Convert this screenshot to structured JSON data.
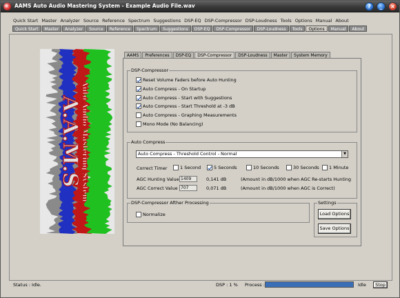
{
  "window": {
    "title": "AAMS Auto Audio Mastering System - Example Audio File.wav",
    "controls": {
      "help": "?",
      "minimize": "_",
      "maximize": "□",
      "close": "×"
    }
  },
  "menu": [
    "Quick Start",
    "Master",
    "Analyzer",
    "Source",
    "Reference",
    "Spectrum",
    "Suggestions",
    "DSP-EQ",
    "DSP-Compressor",
    "DSP-Loudness",
    "Tools",
    "Options",
    "Manual",
    "About"
  ],
  "toolbar_tabs": [
    "Quick Start",
    "Master",
    "Analyzer",
    "Source",
    "Reference",
    "Spectrum",
    "Suggestions",
    "DSP-EQ",
    "DSP-Compressor",
    "DSP-Loudness",
    "Tools",
    "Options",
    "Manual",
    "About"
  ],
  "toolbar_active": "Options",
  "logo": {
    "title": "A.A.M.S",
    "subtitle": "Auto Audio Mastering System"
  },
  "option_tabs": [
    "AAMS",
    "Preferences",
    "DSP-EQ",
    "DSP-Compressor",
    "DSP-Loudness",
    "Master",
    "System Memory"
  ],
  "option_active": "DSP-Compressor",
  "dsp_compressor": {
    "legend": "DSP-Compressor",
    "options": [
      {
        "label": "Reset Volume Faders before Auto Hunting",
        "checked": true
      },
      {
        "label": "Auto Compress - On Startup",
        "checked": true
      },
      {
        "label": "Auto Compress - Start with Suggestions",
        "checked": true
      },
      {
        "label": "Auto Compress - Start Threshold  at -3 dB",
        "checked": true
      },
      {
        "label": "Auto Compress - Graphing Measurements",
        "checked": false
      },
      {
        "label": "Mono Mode (No Balancing)",
        "checked": false
      }
    ]
  },
  "auto_compress": {
    "legend": "Auto Compress",
    "selected": "Auto Compress - Threshold Control - Normal",
    "timer_label": "Correct Timer",
    "timer_options": [
      {
        "label": "1 Second",
        "checked": false
      },
      {
        "label": "5 Seconds",
        "checked": true
      },
      {
        "label": "10 Seconds",
        "checked": false
      },
      {
        "label": "30 Seconds",
        "checked": false
      },
      {
        "label": "1 Minute",
        "checked": false
      }
    ],
    "hunting_label": "AGC Hunting Value",
    "hunting_value": "1409",
    "hunting_db": "0,141 dB",
    "hunting_note": "(Amount in dB/1000  when AGC Re-starts Hunting",
    "correct_label": "AGC Correct Value",
    "correct_value": "707",
    "correct_db": "0,071 dB",
    "correct_note": "(Amount in dB/1000 when AGC is Correct)"
  },
  "after_processing": {
    "legend": "DSP-Compressor Afther Processing",
    "normalize": {
      "label": "Normalize",
      "checked": false
    }
  },
  "settings": {
    "legend": "Settings",
    "load": "Load Options",
    "save": "Save Options"
  },
  "status": {
    "status_text": "Status :  Idle.",
    "dsp_text": "DSP :  1 %",
    "process_label": "Process :",
    "process_percent": 100,
    "state": "Idle",
    "stop": "Stop"
  }
}
